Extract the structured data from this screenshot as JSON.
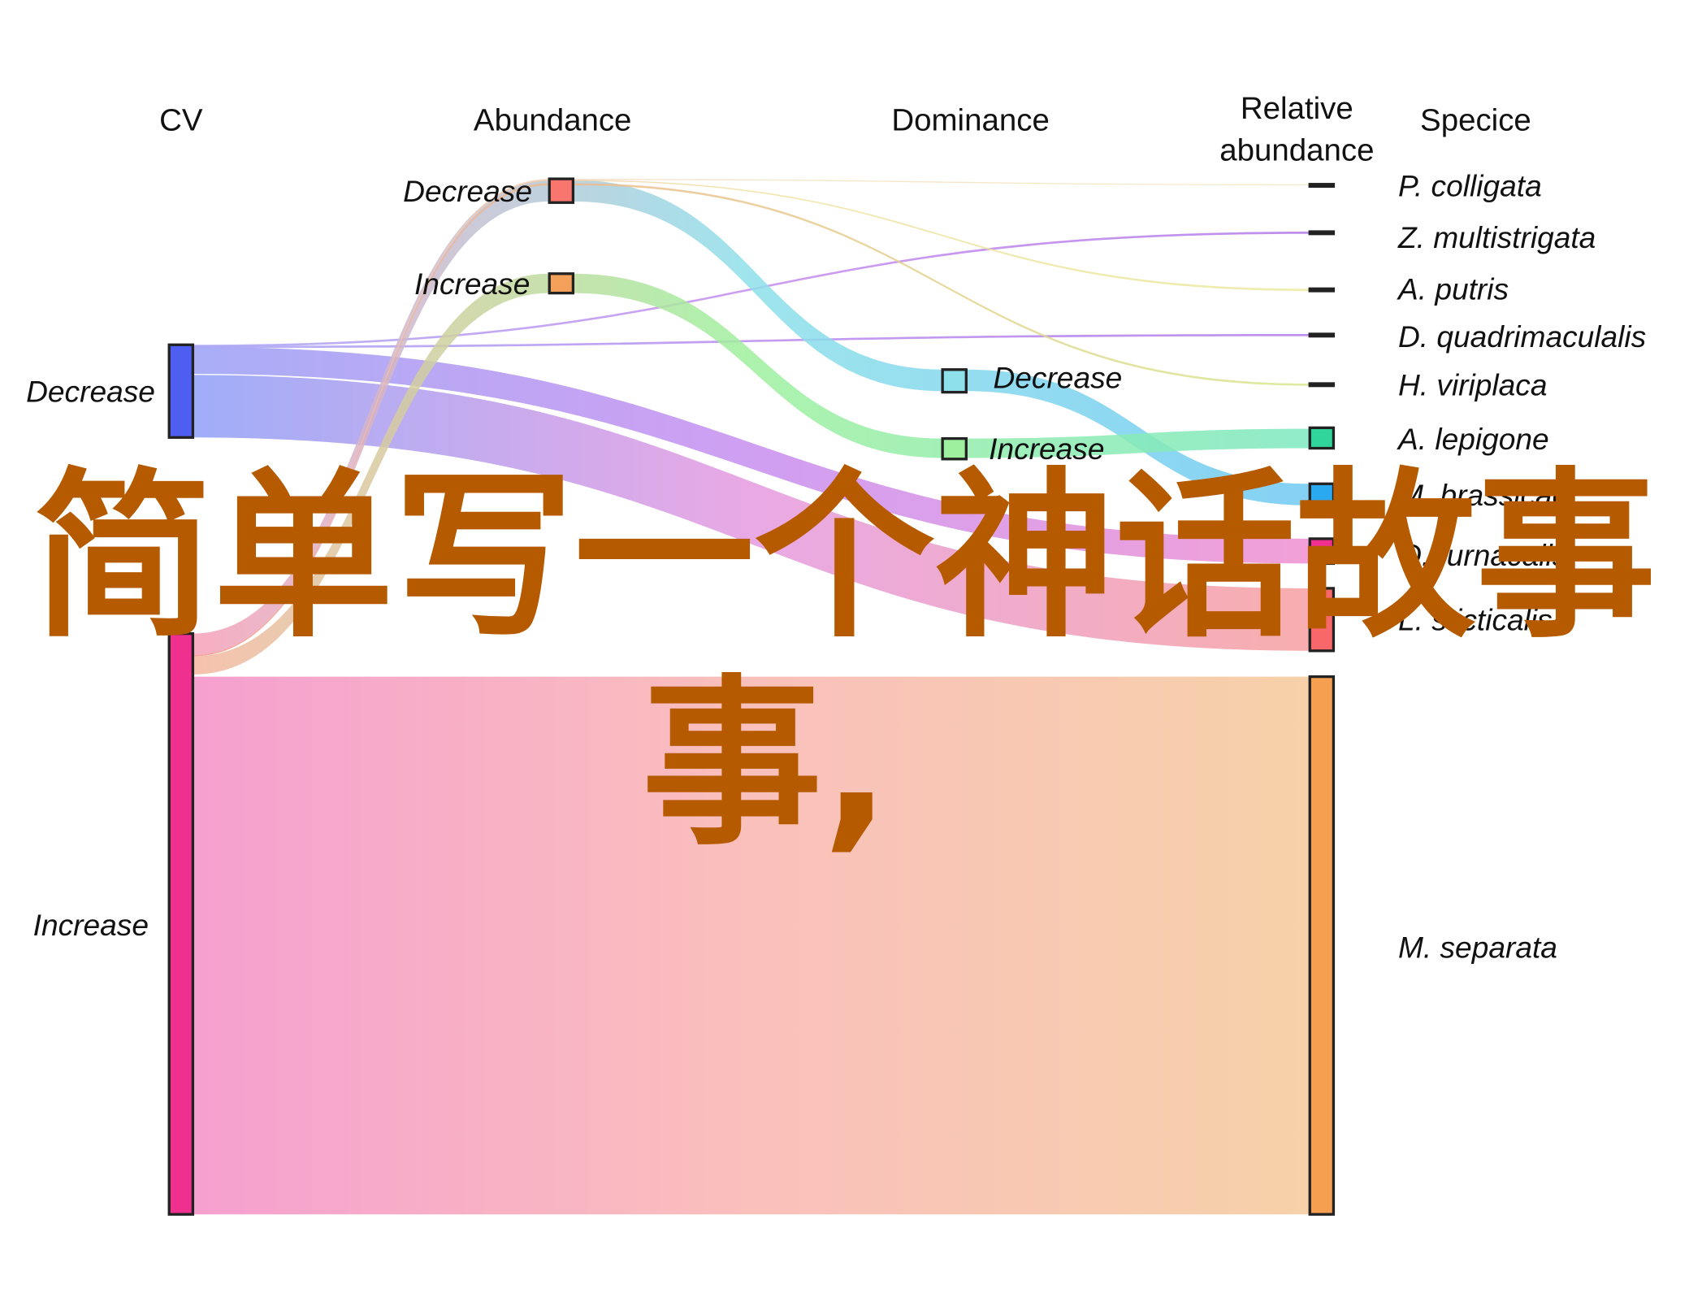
{
  "chart_data": {
    "type": "alluvial",
    "axes": [
      "CV",
      "Abundance",
      "Dominance",
      "Relative abundance",
      "Specice"
    ],
    "axis_title_lines": {
      "relative": [
        "Relative",
        "abundance"
      ]
    },
    "nodes": {
      "cv": [
        {
          "label": "Decrease",
          "color": "#4e5ef0"
        },
        {
          "label": "Increase",
          "color": "#f0308f"
        }
      ],
      "abundance": [
        {
          "label": "Decrease",
          "color": "#f8766d"
        },
        {
          "label": "Increase",
          "color": "#f5a05a"
        }
      ],
      "dominance": [
        {
          "label": "Decrease",
          "color": "#8ee0ea"
        },
        {
          "label": "Increase",
          "color": "#9ef09e"
        }
      ],
      "species": [
        {
          "label": "P. colligata",
          "color": "#333333"
        },
        {
          "label": "Z. multistrigata",
          "color": "#2a2438"
        },
        {
          "label": "A. putris",
          "color": "#333328"
        },
        {
          "label": "D. quadrimaculalis",
          "color": "#2a2438"
        },
        {
          "label": "H. viriplaca",
          "color": "#30382a"
        },
        {
          "label": "A. lepigone",
          "color": "#2fd59a"
        },
        {
          "label": "M. brassicae",
          "color": "#2aa9f0"
        },
        {
          "label": "O. furnacalis",
          "color": "#f02f90"
        },
        {
          "label": "L. sticticalis",
          "color": "#f8676a"
        },
        {
          "label": "M. separata",
          "color": "#f5a050"
        }
      ]
    },
    "flows": [
      {
        "species": "M. separata",
        "cv": "Increase",
        "abundance": null,
        "dominance": null,
        "colors": [
          "#f48fc7",
          "#f9b5b0",
          "#f5c99a"
        ]
      },
      {
        "species": "L. sticticalis",
        "cv": "Decrease",
        "abundance": null,
        "dominance": null,
        "colors": [
          "#8f9ff7",
          "#e59ae0",
          "#f7a0a0"
        ]
      },
      {
        "species": "O. furnacalis",
        "cv": "Decrease",
        "abundance": null,
        "dominance": null,
        "colors": [
          "#9aa0f5",
          "#c78ef0",
          "#f090d0"
        ]
      },
      {
        "species": "Z. multistrigata",
        "cv": "Decrease",
        "abundance": null,
        "dominance": null,
        "colors": [
          "#a9a6f4",
          "#c58cf0",
          "#b27be8"
        ]
      },
      {
        "species": "D. quadrimaculalis",
        "cv": "Decrease",
        "abundance": null,
        "dominance": null,
        "colors": [
          "#a9a6f4",
          "#b98cf0",
          "#b27be8"
        ]
      },
      {
        "species": "M. brassicae",
        "cv": "Increase",
        "abundance": "Decrease",
        "dominance": "Decrease",
        "colors": [
          "#f7a0b8",
          "#8ee0ea",
          "#6fc9f2"
        ]
      },
      {
        "species": "A. lepigone",
        "cv": "Increase",
        "abundance": "Increase",
        "dominance": "Increase",
        "colors": [
          "#f5b7a0",
          "#9ef09e",
          "#7de8c0"
        ]
      },
      {
        "species": "P. colligata",
        "cv": "Increase",
        "abundance": "Decrease",
        "dominance": null,
        "colors": [
          "#f7c0c0",
          "#f4e0c0",
          "#f0e8c0"
        ]
      },
      {
        "species": "A. putris",
        "cv": "Increase",
        "abundance": "Decrease",
        "dominance": null,
        "colors": [
          "#f7b0b0",
          "#f0e0a0",
          "#eaeaa0"
        ]
      },
      {
        "species": "H. viriplaca",
        "cv": "Increase",
        "abundance": "Decrease",
        "dominance": null,
        "colors": [
          "#f7a090",
          "#e8c890",
          "#d8e890"
        ]
      }
    ]
  },
  "overlay_text": {
    "line1": "简单写一个神话故事",
    "line2": "事,"
  }
}
